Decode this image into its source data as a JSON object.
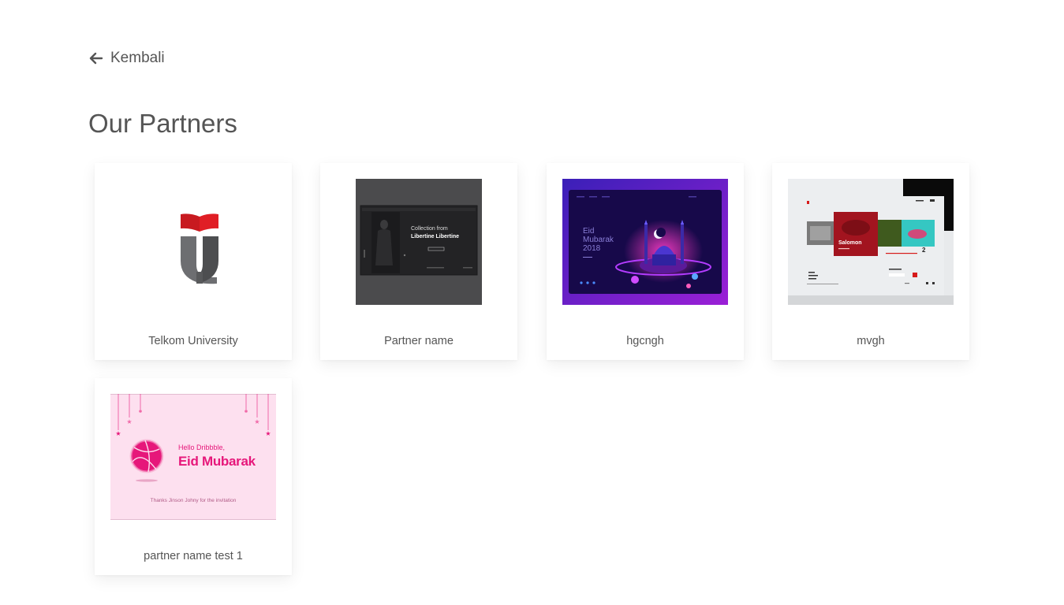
{
  "nav": {
    "back_label": "Kembali"
  },
  "page": {
    "title": "Our Partners"
  },
  "partners": [
    {
      "name": "Telkom University"
    },
    {
      "name": "Partner name",
      "thumb_text": {
        "headline": "Collection from",
        "subhead": "Libertine Libertine"
      }
    },
    {
      "name": "hgcngh",
      "thumb_text": {
        "line1": "Eid",
        "line2": "Mubarak",
        "line3": "2018"
      }
    },
    {
      "name": "mvgh",
      "thumb_text": {
        "brand": "Salomon",
        "number": "2"
      }
    },
    {
      "name": "partner name test 1",
      "thumb_text": {
        "greeting": "Hello Dribbble,",
        "headline": "Eid Mubarak",
        "thanks": "Thanks Jinson Johny for the invitation"
      }
    }
  ],
  "colors": {
    "telkom_red": "#e01e25",
    "telkom_grey": "#6d6e71",
    "eid_pink": "#e6177a"
  }
}
